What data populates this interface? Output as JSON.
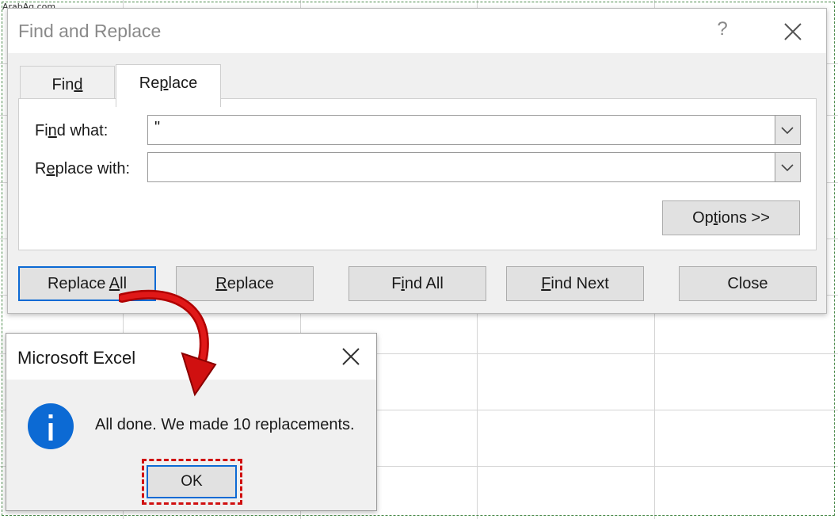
{
  "watermark": "ArabAq.com",
  "colors": {
    "accent": "#0c6ad4",
    "annotation": "#d01010",
    "info": "#0c6ad4"
  },
  "find_replace": {
    "title": "Find and Replace",
    "help_label": "?",
    "close_icon": "close-icon",
    "tabs": [
      {
        "label": "Find",
        "hotkey_index": 3,
        "active": false
      },
      {
        "label": "Replace",
        "hotkey_index": 2,
        "active": true
      }
    ],
    "find_what": {
      "label": "Find what:",
      "value": "\""
    },
    "replace_with": {
      "label": "Replace with:",
      "value": ""
    },
    "options_label": "Options >>",
    "buttons": [
      "Replace All",
      "Replace",
      "Find All",
      "Find Next",
      "Close"
    ]
  },
  "message_box": {
    "title": "Microsoft Excel",
    "icon": "info-icon",
    "message": "All done. We made 10 replacements.",
    "ok_label": "OK"
  }
}
